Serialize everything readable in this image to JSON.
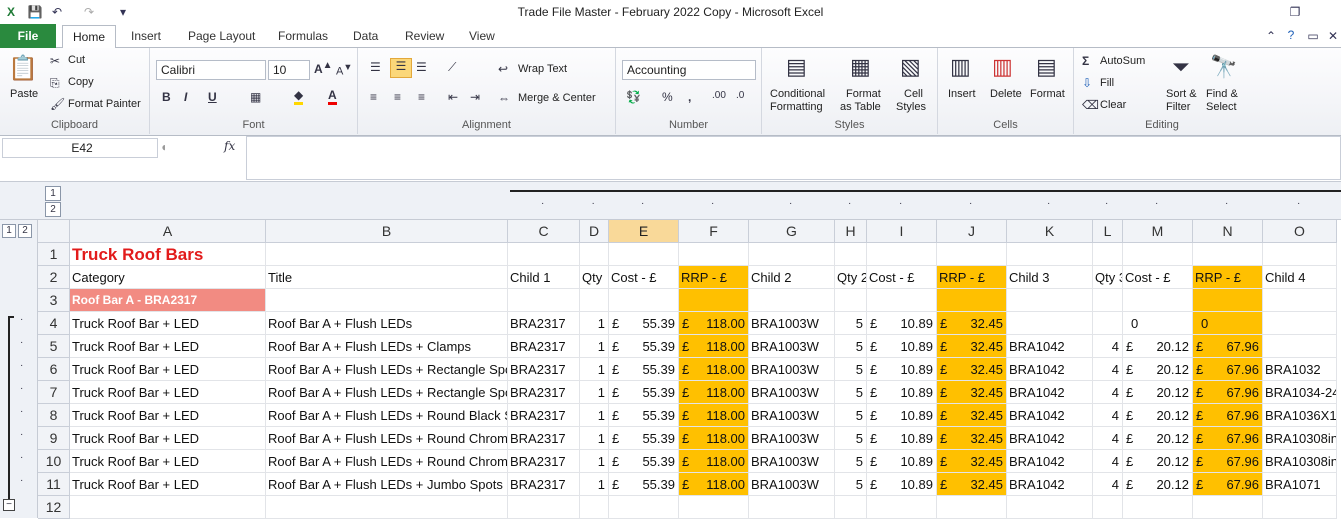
{
  "window": {
    "title": "Trade File Master - February 2022 Copy  -  Microsoft Excel"
  },
  "tabs": [
    "File",
    "Home",
    "Insert",
    "Page Layout",
    "Formulas",
    "Data",
    "Review",
    "View"
  ],
  "ribbon": {
    "clipboard": {
      "paste": "Paste",
      "cut": "Cut",
      "copy": "Copy",
      "format_painter": "Format Painter",
      "label": "Clipboard"
    },
    "font": {
      "name": "Calibri",
      "size": "10",
      "label": "Font"
    },
    "alignment": {
      "wrap": "Wrap Text",
      "merge": "Merge & Center",
      "label": "Alignment"
    },
    "number": {
      "format": "Accounting",
      "label": "Number"
    },
    "styles": {
      "conditional": "Conditional",
      "conditional2": "Formatting",
      "format_table": "Format",
      "format_table2": "as Table",
      "cell_styles": "Cell",
      "cell_styles2": "Styles",
      "label": "Styles"
    },
    "cells": {
      "insert": "Insert",
      "delete": "Delete",
      "format": "Format",
      "label": "Cells"
    },
    "editing": {
      "autosum": "AutoSum",
      "fill": "Fill",
      "clear": "Clear",
      "sort": "Sort &",
      "sort2": "Filter",
      "find": "Find &",
      "find2": "Select",
      "label": "Editing"
    }
  },
  "formula_bar": {
    "name_box": "E42",
    "fx": "fx"
  },
  "outline": {
    "level1": "1",
    "level2": "2"
  },
  "columns": [
    "A",
    "B",
    "C",
    "D",
    "E",
    "F",
    "G",
    "H",
    "I",
    "J",
    "K",
    "L",
    "M",
    "N",
    "O"
  ],
  "rows": [
    {
      "n": "1",
      "cells": {
        "A": "Truck Roof Bars"
      }
    },
    {
      "n": "2",
      "cells": {
        "A": "Category",
        "B": "Title",
        "C": "Child 1",
        "D": "Qty",
        "E": "Cost - £",
        "F": "RRP - £",
        "G": "Child 2",
        "H": "Qty 2",
        "I": "Cost - £",
        "J": "RRP - £",
        "K": "Child 3",
        "L": "Qty 3",
        "M": "Cost - £",
        "N": "RRP - £",
        "O": "Child 4"
      }
    },
    {
      "n": "3",
      "cells": {
        "A": "Roof Bar A - BRA2317"
      }
    },
    {
      "n": "4",
      "cells": {
        "A": "Truck Roof Bar + LED",
        "B": "Roof Bar A + Flush LEDs",
        "C": "BRA2317",
        "D": "1",
        "E": "55.39",
        "F": "118.00",
        "G": "BRA1003W",
        "H": "5",
        "I": "10.89",
        "J": "32.45",
        "K": "",
        "L": "",
        "M": "0",
        "N": "0",
        "O": ""
      }
    },
    {
      "n": "5",
      "cells": {
        "A": "Truck Roof Bar + LED",
        "B": "Roof Bar A + Flush LEDs + Clamps",
        "C": "BRA2317",
        "D": "1",
        "E": "55.39",
        "F": "118.00",
        "G": "BRA1003W",
        "H": "5",
        "I": "10.89",
        "J": "32.45",
        "K": "BRA1042",
        "L": "4",
        "M": "20.12",
        "N": "67.96",
        "O": ""
      }
    },
    {
      "n": "6",
      "cells": {
        "A": "Truck Roof Bar + LED",
        "B": "Roof Bar A + Flush LEDs + Rectangle Spo",
        "C": "BRA2317",
        "D": "1",
        "E": "55.39",
        "F": "118.00",
        "G": "BRA1003W",
        "H": "5",
        "I": "10.89",
        "J": "32.45",
        "K": "BRA1042",
        "L": "4",
        "M": "20.12",
        "N": "67.96",
        "O": "BRA1032"
      }
    },
    {
      "n": "7",
      "cells": {
        "A": "Truck Roof Bar + LED",
        "B": "Roof Bar A + Flush LEDs + Rectangle Spo",
        "C": "BRA2317",
        "D": "1",
        "E": "55.39",
        "F": "118.00",
        "G": "BRA1003W",
        "H": "5",
        "I": "10.89",
        "J": "32.45",
        "K": "BRA1042",
        "L": "4",
        "M": "20.12",
        "N": "67.96",
        "O": "BRA1034-24"
      }
    },
    {
      "n": "8",
      "cells": {
        "A": "Truck Roof Bar + LED",
        "B": "Roof Bar A + Flush LEDs + Round Black S",
        "C": "BRA2317",
        "D": "1",
        "E": "55.39",
        "F": "118.00",
        "G": "BRA1003W",
        "H": "5",
        "I": "10.89",
        "J": "32.45",
        "K": "BRA1042",
        "L": "4",
        "M": "20.12",
        "N": "67.96",
        "O": "BRA1036X1"
      }
    },
    {
      "n": "9",
      "cells": {
        "A": "Truck Roof Bar + LED",
        "B": "Roof Bar A + Flush LEDs + Round Chrom",
        "C": "BRA2317",
        "D": "1",
        "E": "55.39",
        "F": "118.00",
        "G": "BRA1003W",
        "H": "5",
        "I": "10.89",
        "J": "32.45",
        "K": "BRA1042",
        "L": "4",
        "M": "20.12",
        "N": "67.96",
        "O": "BRA10308in"
      }
    },
    {
      "n": "10",
      "cells": {
        "A": "Truck Roof Bar + LED",
        "B": "Roof Bar A + Flush LEDs + Round Chrom",
        "C": "BRA2317",
        "D": "1",
        "E": "55.39",
        "F": "118.00",
        "G": "BRA1003W",
        "H": "5",
        "I": "10.89",
        "J": "32.45",
        "K": "BRA1042",
        "L": "4",
        "M": "20.12",
        "N": "67.96",
        "O": "BRA10308in"
      }
    },
    {
      "n": "11",
      "cells": {
        "A": "Truck Roof Bar + LED",
        "B": "Roof Bar A + Flush LEDs + Jumbo Spots",
        "C": "BRA2317",
        "D": "1",
        "E": "55.39",
        "F": "118.00",
        "G": "BRA1003W",
        "H": "5",
        "I": "10.89",
        "J": "32.45",
        "K": "BRA1042",
        "L": "4",
        "M": "20.12",
        "N": "67.96",
        "O": "BRA1071"
      }
    },
    {
      "n": "12",
      "cells": {}
    }
  ],
  "currency": "£",
  "colors": {
    "orange": "#ffc000",
    "salmon": "#f28b82",
    "title_red": "#e21b1b",
    "file_green": "#2a8a3e"
  }
}
